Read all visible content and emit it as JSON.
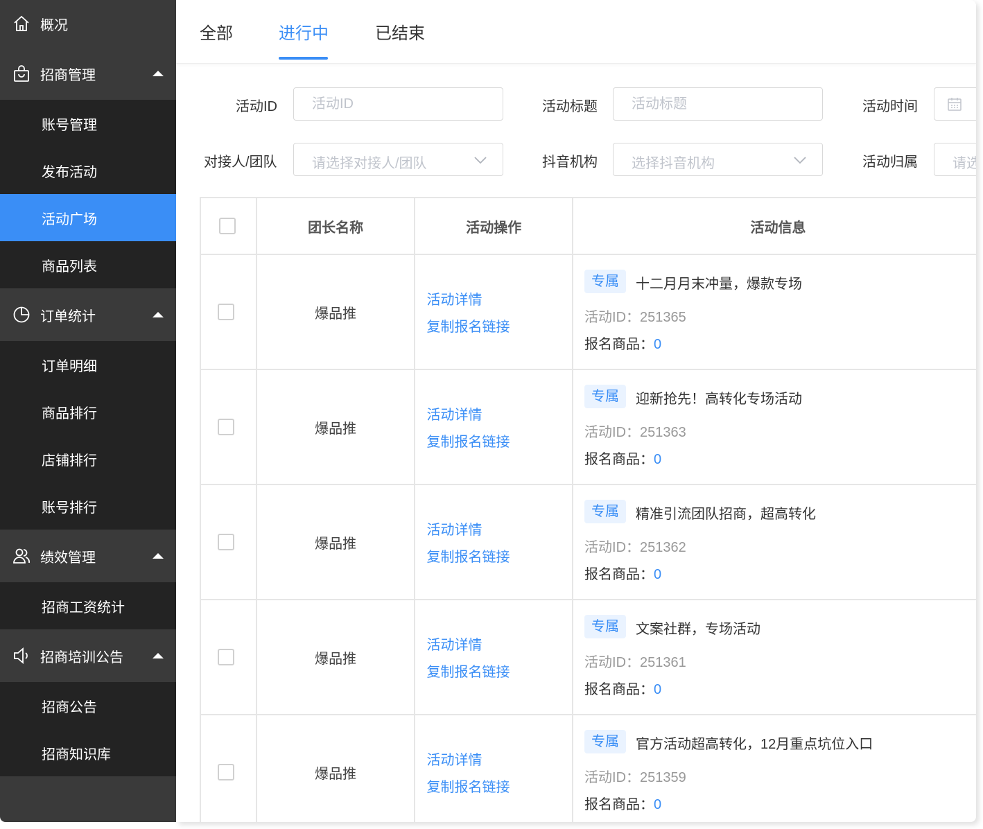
{
  "sidebar": {
    "overview": {
      "label": "概况",
      "icon": "home-icon"
    },
    "groups": [
      {
        "label": "招商管理",
        "icon": "bag-icon",
        "items": [
          "账号管理",
          "发布活动",
          "活动广场",
          "商品列表"
        ],
        "active_item": "活动广场"
      },
      {
        "label": "订单统计",
        "icon": "pie-chart-icon",
        "items": [
          "订单明细",
          "商品排行",
          "店铺排行",
          "账号排行"
        ]
      },
      {
        "label": "绩效管理",
        "icon": "users-icon",
        "items": [
          "招商工资统计"
        ]
      },
      {
        "label": "招商培训公告",
        "icon": "speaker-icon",
        "items": [
          "招商公告",
          "招商知识库"
        ]
      }
    ]
  },
  "tabs": [
    "全部",
    "进行中",
    "已结束"
  ],
  "active_tab": "进行中",
  "filters": {
    "activity_id": {
      "label": "活动ID",
      "placeholder": "活动ID"
    },
    "activity_title": {
      "label": "活动标题",
      "placeholder": "活动标题"
    },
    "activity_time": {
      "label": "活动时间"
    },
    "contact": {
      "label": "对接人/团队",
      "placeholder": "请选择对接人/团队"
    },
    "douyin_org": {
      "label": "抖音机构",
      "placeholder": "选择抖音机构"
    },
    "belong": {
      "label": "活动归属",
      "placeholder": "请选"
    }
  },
  "table": {
    "headers": [
      "团长名称",
      "活动操作",
      "活动信息"
    ],
    "rows": [
      {
        "leader": "爆品推",
        "op_detail": "活动详情",
        "op_copy": "复制报名链接",
        "badge": "专属",
        "title": "十二月月末冲量，爆款专场",
        "id_text": "活动ID：251365",
        "goods_label": "报名商品：",
        "goods_count": "0"
      },
      {
        "leader": "爆品推",
        "op_detail": "活动详情",
        "op_copy": "复制报名链接",
        "badge": "专属",
        "title": "迎新抢先！高转化专场活动",
        "id_text": "活动ID：251363",
        "goods_label": "报名商品：",
        "goods_count": "0"
      },
      {
        "leader": "爆品推",
        "op_detail": "活动详情",
        "op_copy": "复制报名链接",
        "badge": "专属",
        "title": "精准引流团队招商，超高转化",
        "id_text": "活动ID：251362",
        "goods_label": "报名商品：",
        "goods_count": "0"
      },
      {
        "leader": "爆品推",
        "op_detail": "活动详情",
        "op_copy": "复制报名链接",
        "badge": "专属",
        "title": "文案社群，专场活动",
        "id_text": "活动ID：251361",
        "goods_label": "报名商品：",
        "goods_count": "0"
      },
      {
        "leader": "爆品推",
        "op_detail": "活动详情",
        "op_copy": "复制报名链接",
        "badge": "专属",
        "title": "官方活动超高转化，12月重点坑位入口",
        "id_text": "活动ID：251359",
        "goods_label": "报名商品：",
        "goods_count": "0"
      }
    ]
  },
  "colors": {
    "accent": "#3a8ef6",
    "sidebar_bg": "#3a3a3a",
    "submenu_bg": "#232323"
  }
}
